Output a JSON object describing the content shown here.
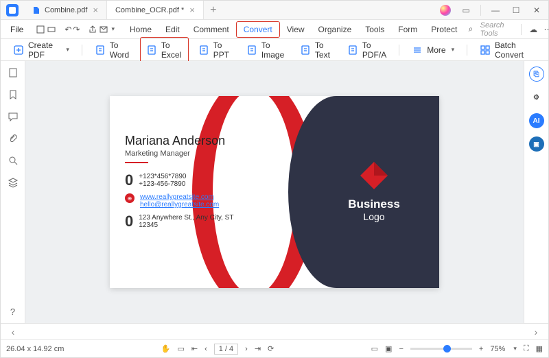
{
  "tabs": {
    "inactive": "Combine.pdf",
    "active": "Combine_OCR.pdf *"
  },
  "menubar": {
    "file": "File",
    "items": [
      "Home",
      "Edit",
      "Comment",
      "Convert",
      "View",
      "Organize",
      "Tools",
      "Form",
      "Protect"
    ],
    "active_index": 3,
    "search_ph": "Search Tools"
  },
  "convertbar": {
    "create": "Create PDF",
    "items": [
      "To Word",
      "To Excel",
      "To PPT",
      "To Image",
      "To Text",
      "To PDF/A"
    ],
    "active_index": 1,
    "more": "More",
    "batch": "Batch Convert"
  },
  "card": {
    "name": "Mariana Anderson",
    "role": "Marketing Manager",
    "phone1": "+123*456*7890",
    "phone2": "+123-456-7890",
    "web": "www.reallygreatsite.com",
    "email": "hello@reallygreatsite.com",
    "addr1": "123 Anywhere St., Any City, ST",
    "addr2": "12345",
    "logo_top": "Business",
    "logo_bot": "Logo"
  },
  "status": {
    "dims": "26.04 x 14.92 cm",
    "page": "1 / 4",
    "zoom": "75%",
    "zoom_pos": 0.6
  }
}
